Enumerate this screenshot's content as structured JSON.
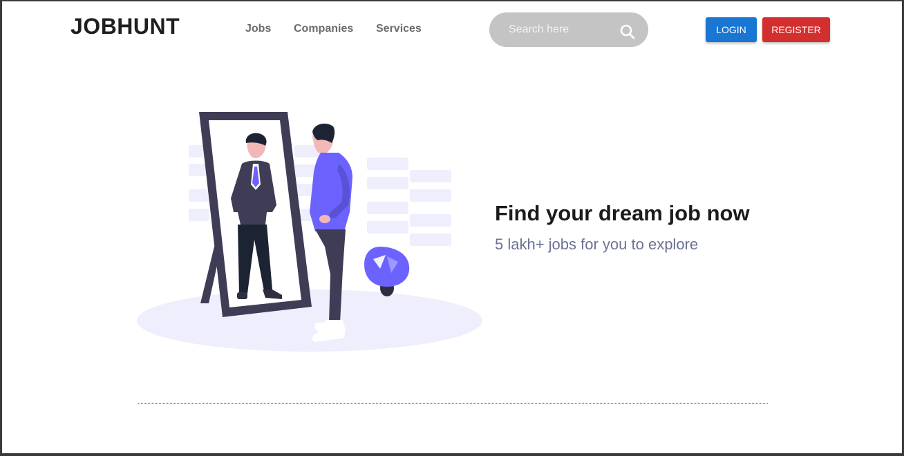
{
  "header": {
    "brand": "JOBHUNT",
    "nav": {
      "jobs": "Jobs",
      "companies": "Companies",
      "services": "Services"
    },
    "search": {
      "placeholder": "Search here",
      "icon": "search-icon"
    },
    "login_label": "LOGIN",
    "register_label": "REGISTER"
  },
  "hero": {
    "title": "Find your dream job now",
    "subtitle": "5 lakh+ jobs for you to explore",
    "illustration": "man-looking-in-mirror-illustration"
  },
  "colors": {
    "login": "#1976d2",
    "register": "#d32f2f",
    "accent": "#6c63ff",
    "search_bg": "#c4c4c4",
    "subtitle": "#6a7294"
  }
}
